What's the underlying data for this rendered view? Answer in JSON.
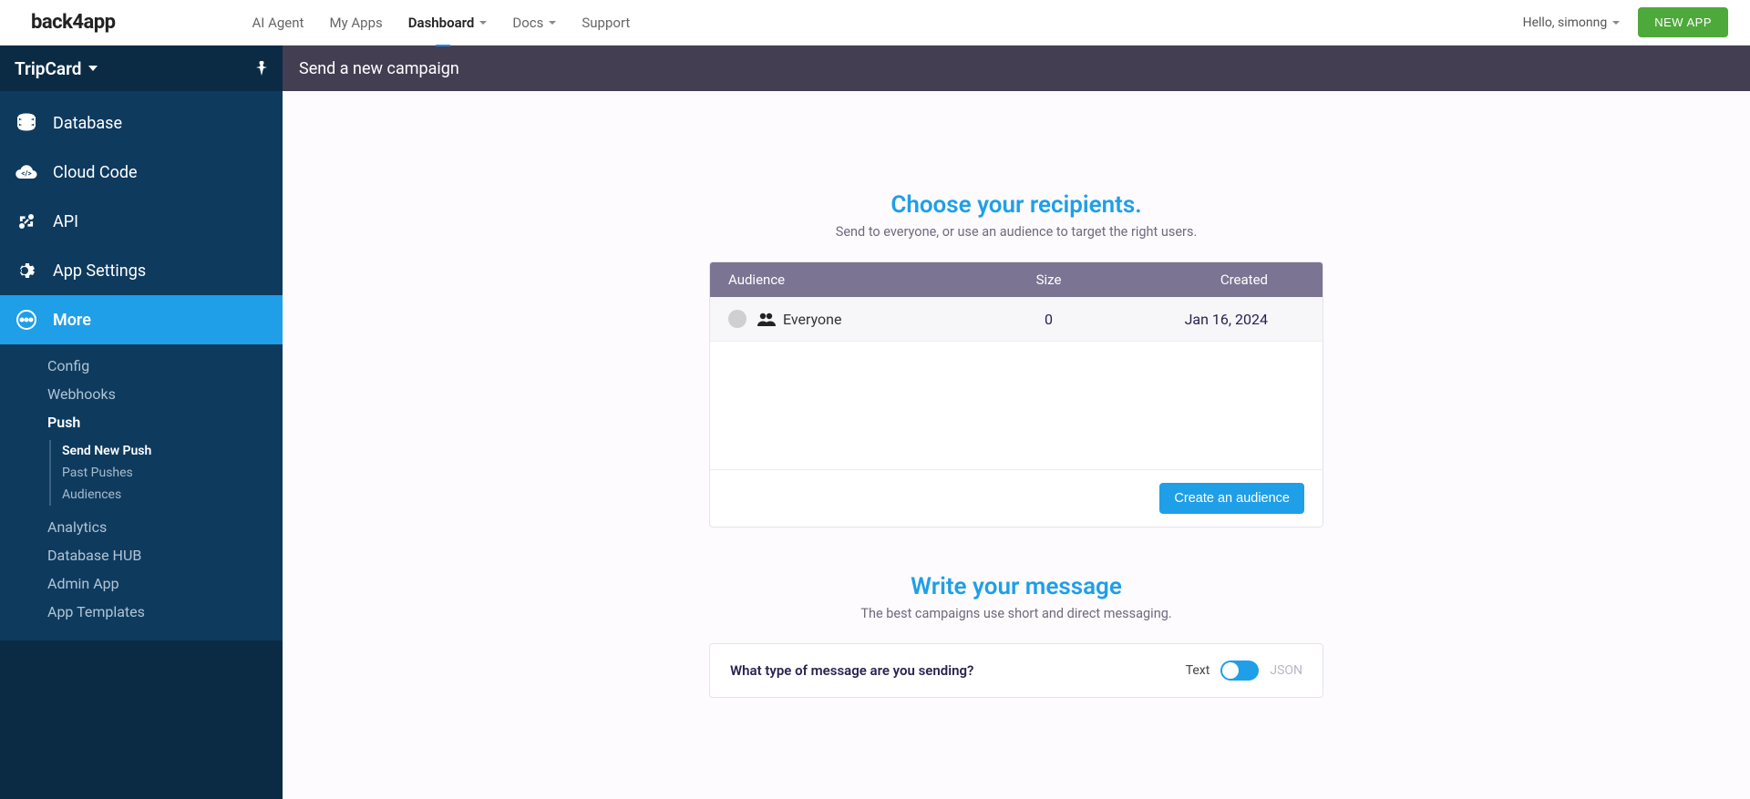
{
  "topbar": {
    "logo": "back4app",
    "nav": {
      "ai_agent": "AI Agent",
      "my_apps": "My Apps",
      "dashboard": "Dashboard",
      "docs": "Docs",
      "support": "Support"
    },
    "greeting": "Hello, simonng",
    "new_app_btn": "NEW APP"
  },
  "sidebar": {
    "app_name": "TripCard",
    "items": {
      "database": "Database",
      "cloud_code": "Cloud Code",
      "api": "API",
      "app_settings": "App Settings",
      "more": "More"
    },
    "more_sub": {
      "config": "Config",
      "webhooks": "Webhooks",
      "push": "Push",
      "push_sub": {
        "send_new_push": "Send New Push",
        "past_pushes": "Past Pushes",
        "audiences": "Audiences"
      },
      "analytics": "Analytics",
      "database_hub": "Database HUB",
      "admin_app": "Admin App",
      "app_templates": "App Templates"
    }
  },
  "titlebar": "Send a new campaign",
  "recipients": {
    "title": "Choose your recipients.",
    "subtitle": "Send to everyone, or use an audience to target the right users.",
    "columns": {
      "audience": "Audience",
      "size": "Size",
      "created": "Created"
    },
    "rows": [
      {
        "name": "Everyone",
        "size": "0",
        "created": "Jan 16, 2024"
      }
    ],
    "create_btn": "Create an audience"
  },
  "message": {
    "title": "Write your message",
    "subtitle": "The best campaigns use short and direct messaging.",
    "question": "What type of message are you sending?",
    "toggle_text": "Text",
    "toggle_json": "JSON"
  }
}
